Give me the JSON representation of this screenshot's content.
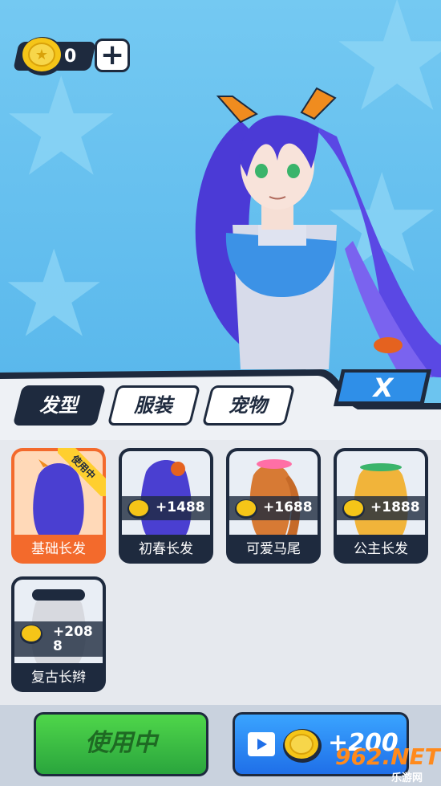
{
  "hud": {
    "coins": "0",
    "add_icon": "plus-icon"
  },
  "close_label": "X",
  "tabs": [
    {
      "label": "发型",
      "active": true
    },
    {
      "label": "服装",
      "active": false
    },
    {
      "label": "宠物",
      "active": false
    }
  ],
  "hairstyles": [
    {
      "name": "基础长发",
      "badge": "使用中",
      "price": null,
      "selected": true,
      "hair_color": "#4a3fd1"
    },
    {
      "name": "初春长发",
      "price": "+1488",
      "selected": false,
      "hair_color": "#4a3fd1"
    },
    {
      "name": "可爱马尾",
      "price": "+1688",
      "selected": false,
      "hair_color": "#d77a34"
    },
    {
      "name": "公主长发",
      "price": "+1888",
      "selected": false,
      "hair_color": "#f1b43a"
    },
    {
      "name": "复古长辫",
      "price": "+208\n8",
      "selected": false,
      "hair_color": "#d7d9df"
    }
  ],
  "buttons": {
    "use_label": "使用中",
    "ad_reward": "+200"
  },
  "watermark": {
    "main": "962.NET",
    "sub": "乐游网"
  },
  "colors": {
    "accent_dark": "#1e2a3e",
    "selected": "#f36a2c",
    "use_green": "#2aa53d",
    "ad_blue": "#1f6fe8",
    "coin_gold": "#f5c518"
  }
}
